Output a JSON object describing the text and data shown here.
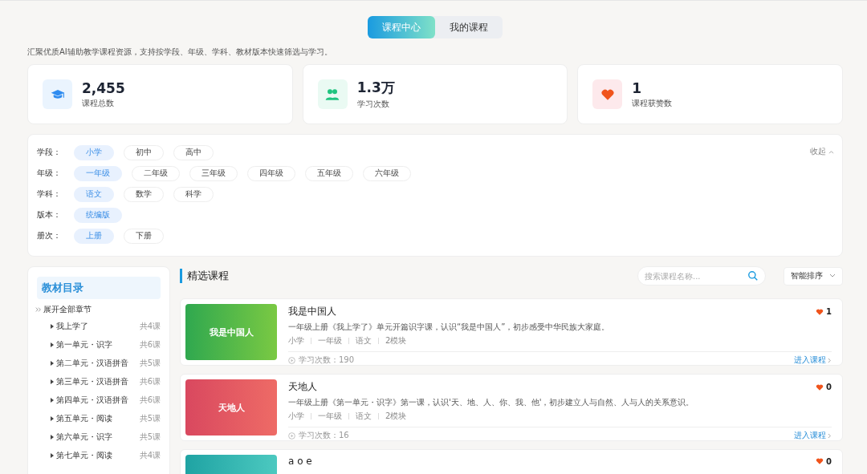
{
  "tabs": [
    {
      "label": "课程中心",
      "selected": true
    },
    {
      "label": "我的课程",
      "selected": false
    }
  ],
  "description": "汇聚优质AI辅助教学课程资源，支持按学段、年级、学科、教材版本快速筛选与学习。",
  "stats": [
    {
      "value": "2,455",
      "label": "课程总数",
      "kind": "courses"
    },
    {
      "value": "1.3万",
      "label": "学习次数",
      "kind": "learners"
    },
    {
      "value": "1",
      "label": "课程获赞数",
      "kind": "likes"
    }
  ],
  "filters": {
    "collapse": "收起",
    "groups": [
      {
        "label": "学段：",
        "options": [
          {
            "label": "小学",
            "selected": true
          },
          {
            "label": "初中",
            "selected": false
          },
          {
            "label": "高中",
            "selected": false
          }
        ]
      },
      {
        "label": "年级：",
        "options": [
          {
            "label": "一年级",
            "selected": true
          },
          {
            "label": "二年级",
            "selected": false
          },
          {
            "label": "三年级",
            "selected": false
          },
          {
            "label": "四年级",
            "selected": false
          },
          {
            "label": "五年级",
            "selected": false
          },
          {
            "label": "六年级",
            "selected": false
          }
        ]
      },
      {
        "label": "学科：",
        "options": [
          {
            "label": "语文",
            "selected": true
          },
          {
            "label": "数学",
            "selected": false
          },
          {
            "label": "科学",
            "selected": false
          }
        ]
      },
      {
        "label": "版本：",
        "options": [
          {
            "label": "统编版",
            "selected": true
          }
        ]
      },
      {
        "label": "册次：",
        "options": [
          {
            "label": "上册",
            "selected": true
          },
          {
            "label": "下册",
            "selected": false
          }
        ]
      }
    ]
  },
  "sidebar": {
    "title": "教材目录",
    "expand_all": "展开全部章节",
    "items": [
      {
        "name": "我上学了",
        "count": "共4课"
      },
      {
        "name": "第一单元・识字",
        "count": "共6课"
      },
      {
        "name": "第二单元・汉语拼音",
        "count": "共5课"
      },
      {
        "name": "第三单元・汉语拼音",
        "count": "共6课"
      },
      {
        "name": "第四单元・汉语拼音",
        "count": "共6课"
      },
      {
        "name": "第五单元・阅读",
        "count": "共5课"
      },
      {
        "name": "第六单元・识字",
        "count": "共5课"
      },
      {
        "name": "第七单元・阅读",
        "count": "共4课"
      }
    ]
  },
  "section": {
    "title": "精选课程",
    "search": {
      "placeholder": "搜索课程名称..."
    },
    "sort": "智能排序"
  },
  "courses": [
    {
      "thumb": "我是中国人",
      "title": "我是中国人",
      "likes": "1",
      "desc": "一年级上册《我上学了》单元开篇识字课，认识“我是中国人”，初步感受中华民族大家庭。",
      "tags": [
        "小学",
        "一年级",
        "语文",
        "2模块"
      ],
      "views": "学习次数：190",
      "enter": "进入课程"
    },
    {
      "thumb": "天地人",
      "title": "天地人",
      "likes": "0",
      "desc": "一年级上册《第一单元・识字》第一课，认识'天、地、人、你、我、他'，初步建立人与自然、人与人的关系意识。",
      "tags": [
        "小学",
        "一年级",
        "语文",
        "2模块"
      ],
      "views": "学习次数：16",
      "enter": "进入课程"
    },
    {
      "title": "a o e",
      "likes": "0"
    }
  ]
}
